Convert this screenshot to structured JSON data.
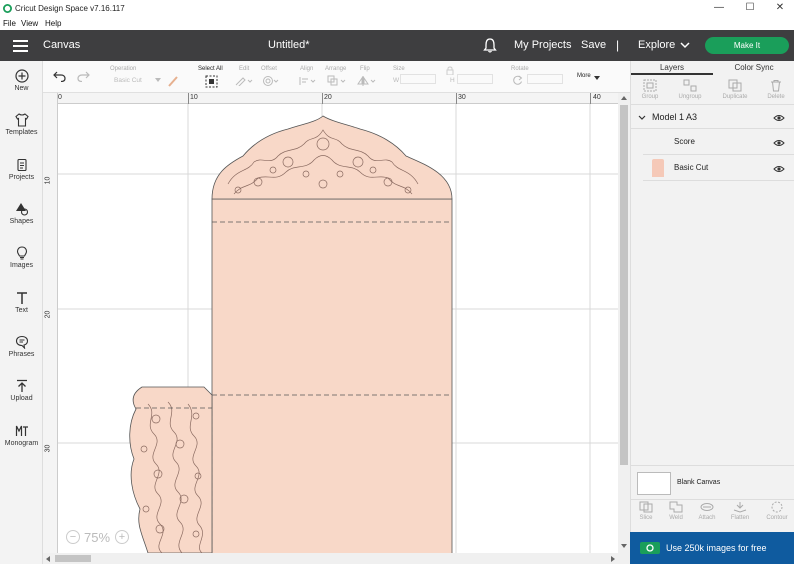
{
  "window": {
    "title": "Cricut Design Space  v7.16.117",
    "minimize": "—",
    "maximize": "☐",
    "close": "✕"
  },
  "menu": [
    "File",
    "View",
    "Help"
  ],
  "header": {
    "section": "Canvas",
    "doc_title": "Untitled*",
    "my_projects": "My Projects",
    "save": "Save",
    "separator": "|",
    "explore": "Explore",
    "make_it": "Make It"
  },
  "sidebar": [
    {
      "label": "New",
      "icon": "plus-circle-icon"
    },
    {
      "label": "Templates",
      "icon": "shirt-icon"
    },
    {
      "label": "Projects",
      "icon": "projects-icon"
    },
    {
      "label": "Shapes",
      "icon": "shapes-icon"
    },
    {
      "label": "Images",
      "icon": "lightbulb-icon"
    },
    {
      "label": "Text",
      "icon": "text-icon"
    },
    {
      "label": "Phrases",
      "icon": "speech-bubble-icon"
    },
    {
      "label": "Upload",
      "icon": "upload-icon"
    },
    {
      "label": "Monogram",
      "icon": "monogram-icon"
    }
  ],
  "toolbar": {
    "operation_label": "Operation",
    "operation_value": "Basic Cut",
    "select_all": "Select All",
    "edit": "Edit",
    "offset": "Offset",
    "align": "Align",
    "arrange": "Arrange",
    "flip": "Flip",
    "size": "Size",
    "size_w": "W",
    "size_h": "H",
    "rotate": "Rotate",
    "more": "More"
  },
  "ruler": {
    "top_ticks": [
      "0",
      "10",
      "20",
      "30",
      "40"
    ],
    "left_ticks": [
      "10",
      "20",
      "30"
    ]
  },
  "zoom": {
    "value": "75%",
    "minus": "−",
    "plus": "+"
  },
  "right_panel": {
    "tabs": [
      "Layers",
      "Color Sync"
    ],
    "tools": [
      "Group",
      "Ungroup",
      "Duplicate",
      "Delete"
    ],
    "layers": {
      "group_name": "Model 1 A3",
      "items": [
        "Score",
        "Basic Cut"
      ]
    },
    "blank_canvas": "Blank Canvas",
    "bottom_tools": [
      "Slice",
      "Weld",
      "Attach",
      "Flatten",
      "Contour"
    ],
    "promo": "Use 250k images for free"
  },
  "colors": {
    "header_bg": "#3e3e40",
    "make_it": "#1a9e5a",
    "shape_fill": "#f8d8c8",
    "promo_bg": "#0f5b9f"
  }
}
